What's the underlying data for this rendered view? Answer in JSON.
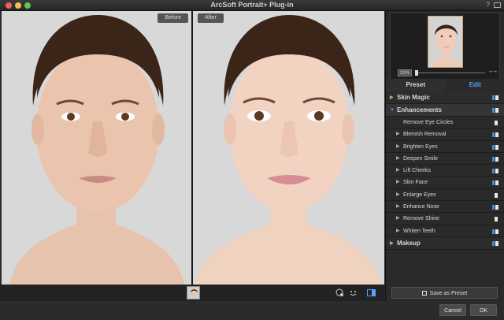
{
  "window": {
    "title": "ArcSoft Portrait+ Plug-in",
    "help": "?"
  },
  "panes": {
    "before_label": "Before",
    "after_label": "After"
  },
  "navigator": {
    "zoom": "31%"
  },
  "tabs": {
    "preset": "Preset",
    "edit": "Edit"
  },
  "list": {
    "skin_magic": "Skin Magic",
    "enhancements": "Enhancements",
    "items": [
      {
        "label": "Remove Eye Circles",
        "expandable": false,
        "toggle": "single"
      },
      {
        "label": "Blemish Removal",
        "expandable": true,
        "toggle": "double"
      },
      {
        "label": "Brighten Eyes",
        "expandable": true,
        "toggle": "double"
      },
      {
        "label": "Deepen Smile",
        "expandable": true,
        "toggle": "double"
      },
      {
        "label": "Lift Cheeks",
        "expandable": true,
        "toggle": "double"
      },
      {
        "label": "Slim Face",
        "expandable": true,
        "toggle": "double"
      },
      {
        "label": "Enlarge Eyes",
        "expandable": true,
        "toggle": "single"
      },
      {
        "label": "Enhance Nose",
        "expandable": true,
        "toggle": "double"
      },
      {
        "label": "Remove Shine",
        "expandable": true,
        "toggle": "single"
      },
      {
        "label": "Whiten Teeth",
        "expandable": true,
        "toggle": "double"
      }
    ],
    "makeup": "Makeup"
  },
  "buttons": {
    "save_preset": "Save as Preset",
    "cancel": "Cancel",
    "ok": "OK"
  },
  "colors": {
    "accent": "#3c9cff",
    "toggle_on": "#3f8ed8"
  }
}
